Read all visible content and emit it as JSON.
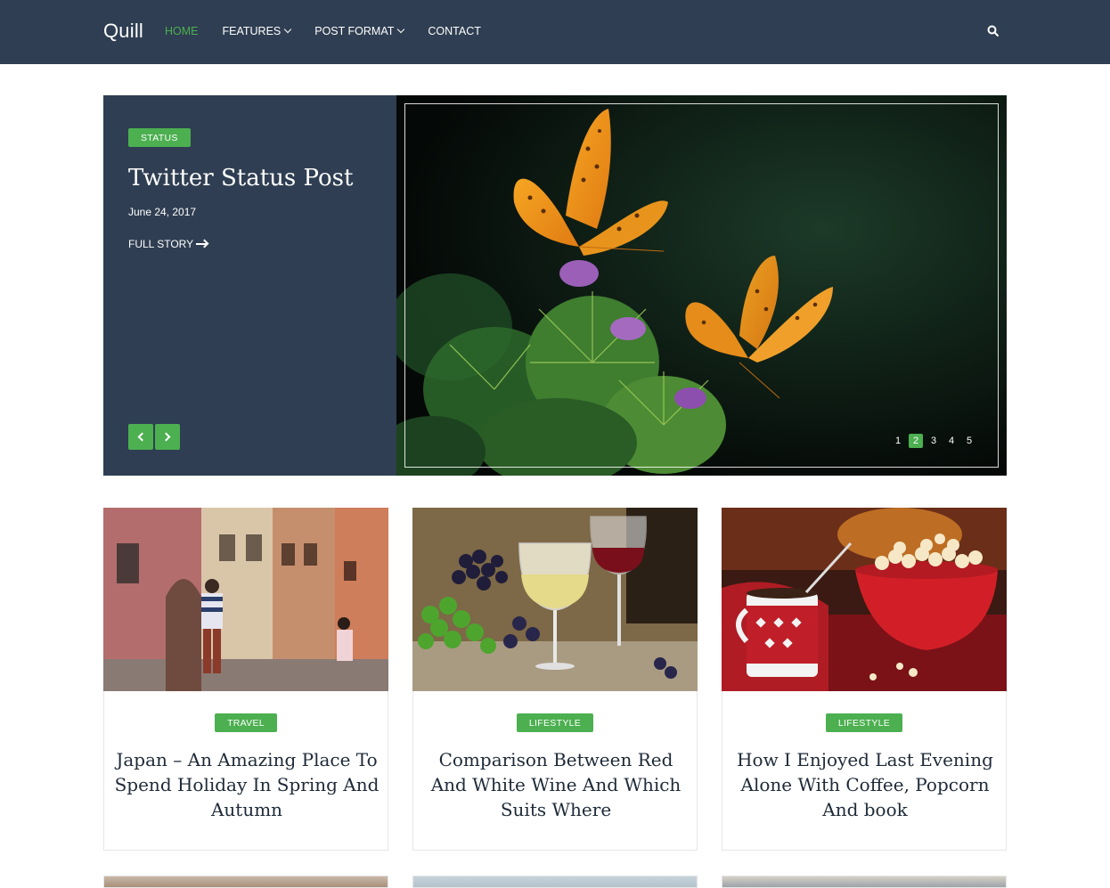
{
  "header": {
    "logo": "Quill",
    "nav": [
      {
        "label": "HOME",
        "active": true,
        "dropdown": false
      },
      {
        "label": "FEATURES",
        "active": false,
        "dropdown": true
      },
      {
        "label": "POST FORMAT",
        "active": false,
        "dropdown": true
      },
      {
        "label": "CONTACT",
        "active": false,
        "dropdown": false
      }
    ],
    "search_icon": "search-icon"
  },
  "hero": {
    "badge": "STATUS",
    "title": "Twitter Status Post",
    "date": "June 24, 2017",
    "more_label": "FULL STORY",
    "dots": [
      "1",
      "2",
      "3",
      "4",
      "5"
    ],
    "active_dot": "2",
    "image": "butterflies on thistle flowers"
  },
  "posts": [
    {
      "category": "TRAVEL",
      "title": "Japan – An Amazing Place To Spend Holiday In Spring And Autumn",
      "image": "street with buildings"
    },
    {
      "category": "LIFESTYLE",
      "title": "Comparison Between Red And White Wine And Which Suits Where",
      "image": "wine glasses and grapes"
    },
    {
      "category": "LIFESTYLE",
      "title": "How I Enjoyed Last Evening Alone With Coffee, Popcorn And book",
      "image": "coffee mug and popcorn"
    }
  ],
  "colors": {
    "header_bg": "#2f3e52",
    "accent": "#4caf50",
    "text_dark": "#1e2a38"
  }
}
